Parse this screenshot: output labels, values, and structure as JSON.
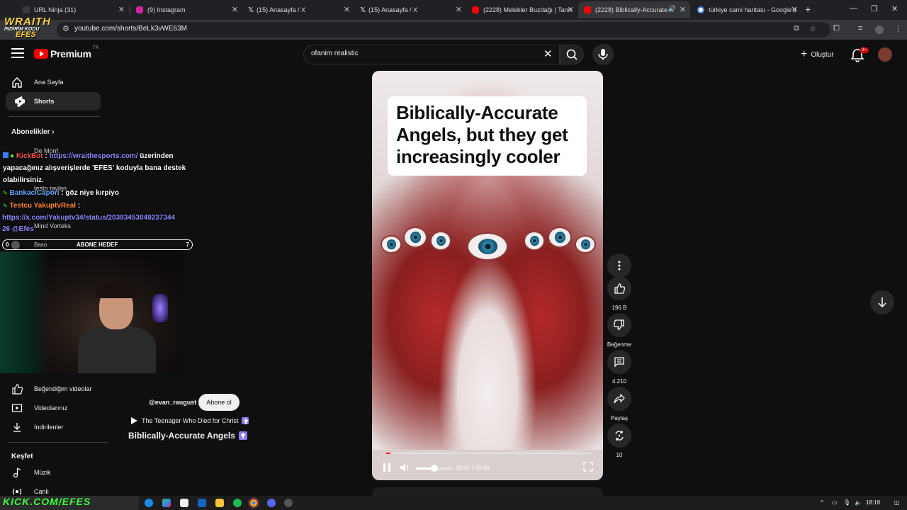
{
  "browser": {
    "tabs": [
      {
        "title": "URL Ninja (31)",
        "color": "#3b3b3b"
      },
      {
        "title": "(9) Instagram",
        "color": "#d6249f"
      },
      {
        "title": "(15) Anasayfa / X",
        "color": "#000000"
      },
      {
        "title": "(15) Anasayfa / X",
        "color": "#000000"
      },
      {
        "title": "(2228) Melekler Buzdağı | Tanrı",
        "color": "#ff0000"
      },
      {
        "title": "(2228) Biblically-Accurate A",
        "color": "#ff0000"
      },
      {
        "title": "türkiye cami haritası - Google'd",
        "color": "#4285f4"
      }
    ],
    "url": "youtube.com/shorts/BeLk3vWE63M"
  },
  "youtube": {
    "logo_text": "Premium",
    "country_code": "TR",
    "search_value": "ofanim realistic",
    "create_label": "Oluştur",
    "notif_count": "9+"
  },
  "sidebar": {
    "items": [
      {
        "label": "Ana Sayfa"
      },
      {
        "label": "Shorts"
      }
    ],
    "subs_heading": "Abonelikler",
    "subs_ghost": [
      "De Monf.",
      "testo taylan",
      "Mind Vorteks",
      "Baso"
    ],
    "lower_items": [
      {
        "label": "Beğendiğim videolar"
      },
      {
        "label": "Videolarınız"
      },
      {
        "label": "İndirilenler"
      }
    ],
    "explore_heading": "Keşfet",
    "explore_items": [
      {
        "label": "Müzik"
      },
      {
        "label": "Canlı"
      }
    ]
  },
  "overlay": {
    "brand_line1": "WRAITH",
    "brand_line2": "İNDİRİM KODU",
    "brand_line3": "EFES",
    "chat": [
      {
        "user": "KickBot",
        "text_pre": " : ",
        "link": "https://wraithesports.com/",
        "text_post": " üzerinden"
      },
      {
        "text": "yapacağınız alışverişlerde 'EFES' koduyla bana destek"
      },
      {
        "text": "olabilirsiniz."
      },
      {
        "user": "BankaciCapori",
        "text": " : göz niye kırpiyo"
      },
      {
        "user": "Testcu YakuptvReal",
        "text": " :"
      },
      {
        "link": "https://x.com/Yakuptv34/status/20393453049237344"
      },
      {
        "link": "26 @Efes"
      }
    ],
    "goal": {
      "left": "0",
      "label": "ABONE HEDEF",
      "right": "7"
    },
    "promo": "KICK.COM/EFES"
  },
  "short": {
    "caption_lines": [
      "Biblically-Accurate",
      "Angels, but they get",
      "increasingly cooler"
    ],
    "channel": "@evan_raugust",
    "subscribe_label": "Abone ol",
    "playlist": "The Teenager Who Died for Christ",
    "title": "Biblically-Accurate Angels",
    "time": "00:01 / 00:46",
    "progress": 0.022,
    "volume": 0.5
  },
  "actions": {
    "likes": "196 B",
    "dislike_label": "Beğenme",
    "comments": "4.210",
    "share_label": "Paylaş",
    "remix_count": "10"
  },
  "taskbar": {
    "time": "18:18"
  }
}
